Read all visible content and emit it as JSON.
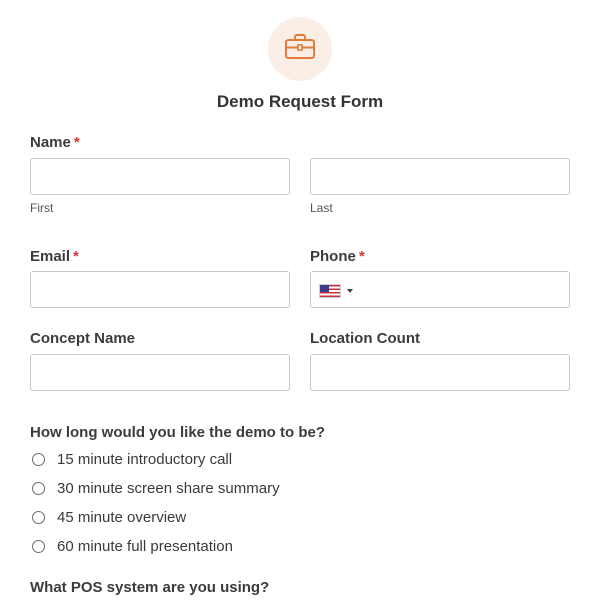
{
  "header": {
    "icon": "briefcase-icon",
    "title": "Demo Request Form",
    "accent_color": "#e07b39",
    "badge_color": "#fbeee6"
  },
  "fields": {
    "name": {
      "label": "Name",
      "required_mark": "*",
      "first_sublabel": "First",
      "last_sublabel": "Last",
      "first_value": "",
      "last_value": ""
    },
    "email": {
      "label": "Email",
      "required_mark": "*",
      "value": ""
    },
    "phone": {
      "label": "Phone",
      "required_mark": "*",
      "country_flag": "us-flag-icon",
      "value": ""
    },
    "concept_name": {
      "label": "Concept Name",
      "value": ""
    },
    "location_count": {
      "label": "Location Count",
      "value": ""
    }
  },
  "demo_length": {
    "question": "How long would you like the demo to be?",
    "options": [
      {
        "label": "15 minute introductory call",
        "selected": false
      },
      {
        "label": "30 minute screen share summary",
        "selected": false
      },
      {
        "label": "45 minute overview",
        "selected": false
      },
      {
        "label": "60 minute full presentation",
        "selected": false
      }
    ]
  },
  "pos_system": {
    "question": "What POS system are you using?"
  },
  "colors": {
    "required": "#d63638",
    "input_border": "#c9c9c9"
  }
}
